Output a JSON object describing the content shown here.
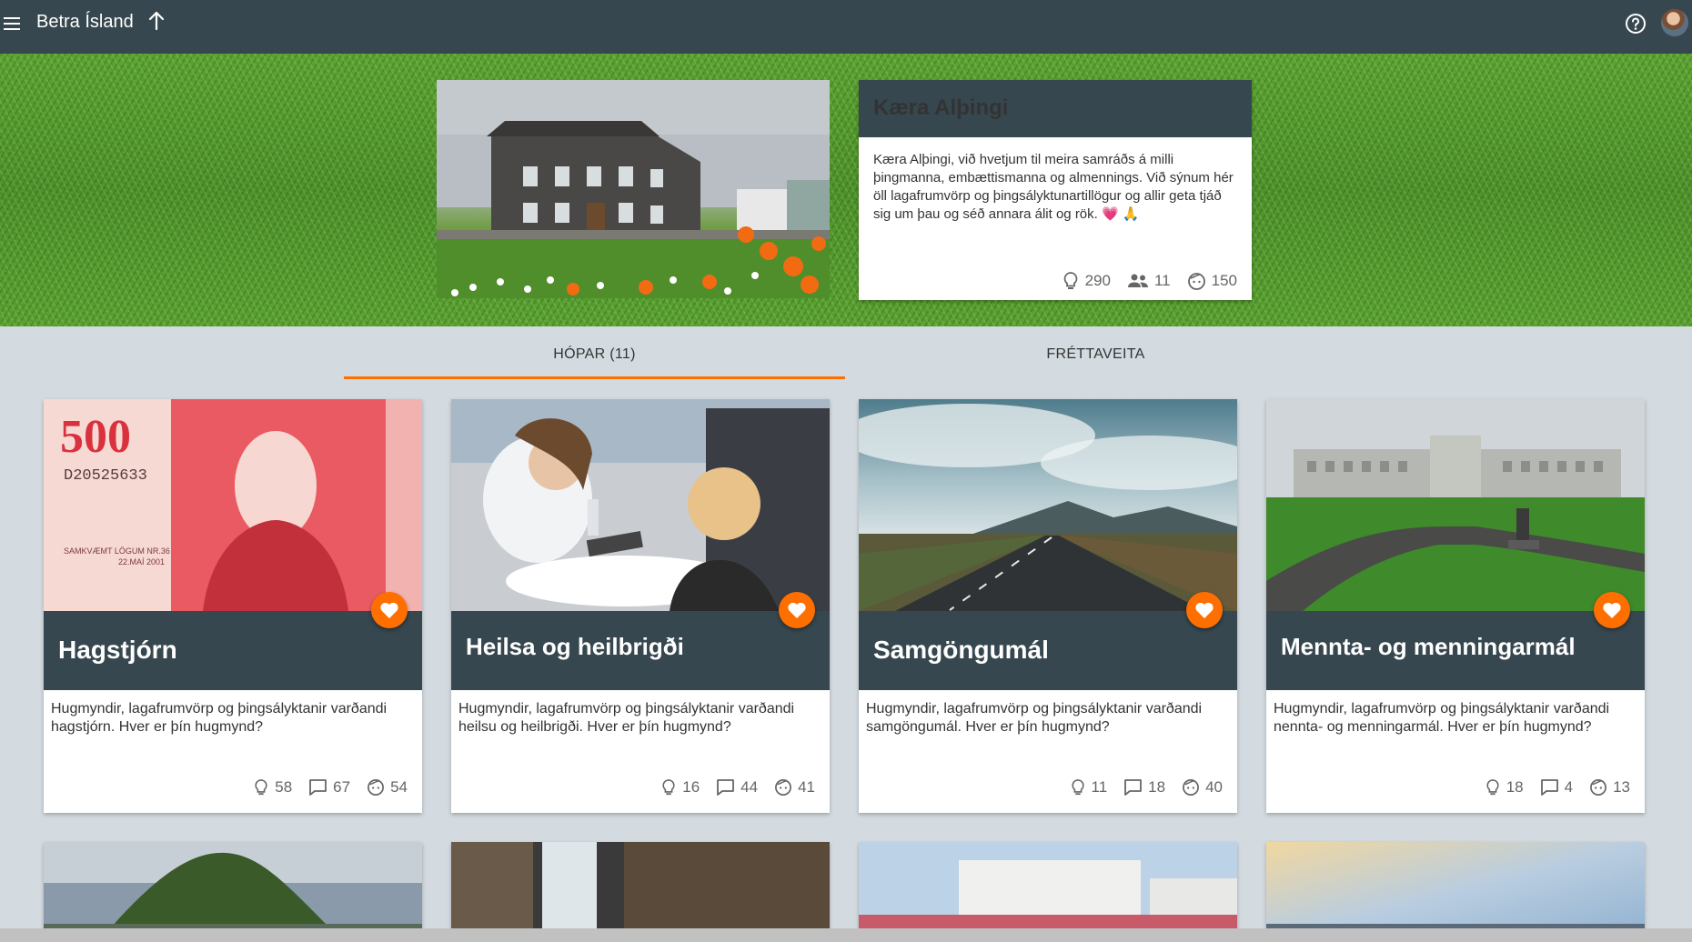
{
  "header": {
    "title": "Betra Ísland",
    "icons": {
      "menu": "menu-icon",
      "up": "arrow-up-icon",
      "help": "help-icon",
      "avatar": "user-avatar"
    }
  },
  "hero": {
    "image_alt": "Alþingishúsið",
    "title": "Kæra Alþingi",
    "description": "Kæra Alþingi, við hvetjum til meira samráðs á milli þingmanna, embættismanna og almennings. Við sýnum hér öll lagafrumvörp og þingsályktunartillögur og allir geta tjáð sig um þau og séð annara álit og rök. 💗 🙏",
    "stats": {
      "ideas": "290",
      "groups": "11",
      "users": "150"
    }
  },
  "tabs": [
    {
      "label": "HÓPAR  (11)",
      "active": true
    },
    {
      "label": "FRÉTTAVEITA",
      "active": false
    }
  ],
  "groups": [
    {
      "title": "Hagstjórn",
      "description": "Hugmyndir, lagafrumvörp og þingsályktanir varðandi hagstjórn. Hver er þín hugmynd?",
      "ideas": "58",
      "comments": "67",
      "users": "54"
    },
    {
      "title": "Heilsa og heilbrigði",
      "description": "Hugmyndir, lagafrumvörp og þingsályktanir varðandi heilsu og heilbrigði. Hver er þín hugmynd?",
      "ideas": "16",
      "comments": "44",
      "users": "41"
    },
    {
      "title": "Samgöngumál",
      "description": "Hugmyndir, lagafrumvörp og þingsályktanir varðandi samgöngumál. Hver er þín hugmynd?",
      "ideas": "11",
      "comments": "18",
      "users": "40"
    },
    {
      "title": "Mennta- og menningarmál",
      "description": "Hugmyndir, lagafrumvörp og þingsályktanir varðandi nennta- og menningarmál. Hver er þín hugmynd?",
      "ideas": "18",
      "comments": "4",
      "users": "13"
    }
  ],
  "colors": {
    "header": "#37474f",
    "accent": "#ff6f00",
    "background": "#d3dbe0"
  }
}
